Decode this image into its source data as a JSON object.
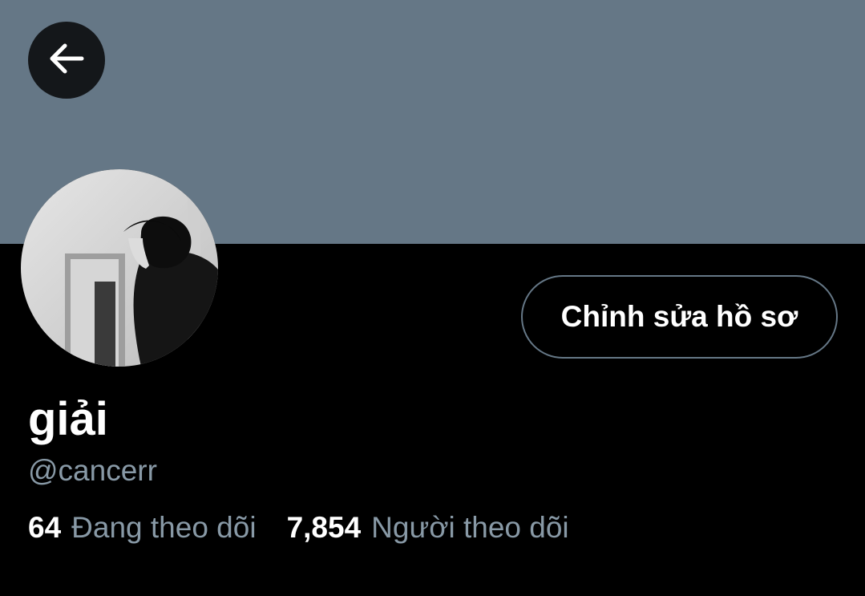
{
  "profile": {
    "display_name": "giải",
    "handle": "@cancerr",
    "edit_button_label": "Chỉnh sửa hồ sơ"
  },
  "stats": {
    "following_count": "64",
    "following_label": "Đang theo dõi",
    "followers_count": "7,854",
    "followers_label": "Người theo dõi"
  },
  "icons": {
    "back": "arrow-left-icon"
  },
  "colors": {
    "banner": "#657786",
    "background": "#000000",
    "secondary_text": "#8899a6",
    "button_border": "#657786"
  }
}
